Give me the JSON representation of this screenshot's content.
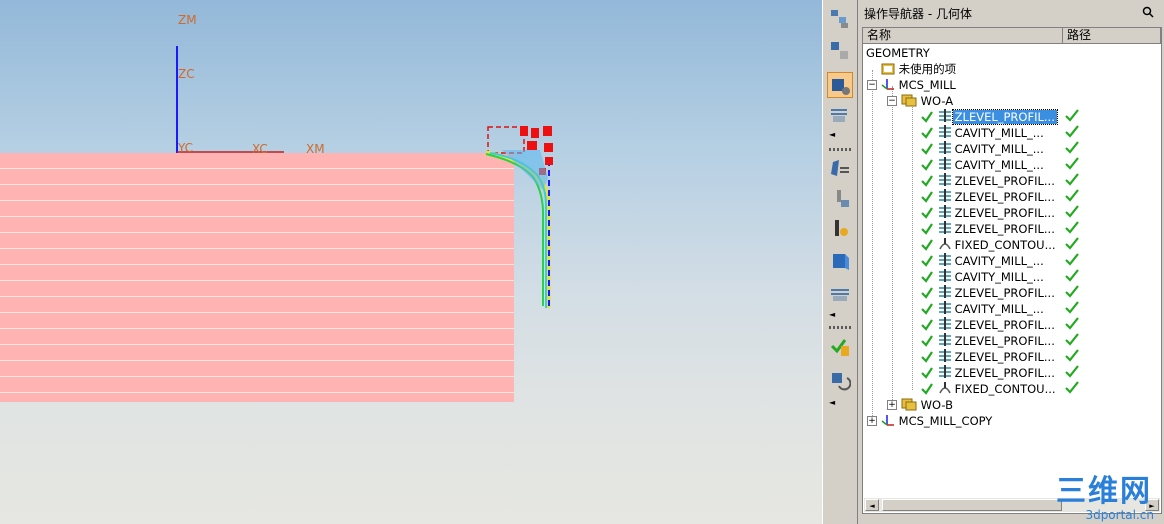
{
  "viewport": {
    "axes": {
      "zm": "ZM",
      "zc": "ZC",
      "yc": "YC",
      "xc": "XC",
      "xm": "XM"
    }
  },
  "navigator": {
    "title": "操作导航器 - 几何体",
    "columns": {
      "name": "名称",
      "path": "路径"
    },
    "tree": {
      "root": "GEOMETRY",
      "unused": "未使用的项",
      "mcs_mill": "MCS_MILL",
      "wo_a": "WO-A",
      "operations": [
        {
          "label": "ZLEVEL_PROFIL...",
          "type": "zlevel",
          "selected": true
        },
        {
          "label": "CAVITY_MILL_...",
          "type": "cavity"
        },
        {
          "label": "CAVITY_MILL_...",
          "type": "cavity"
        },
        {
          "label": "CAVITY_MILL_...",
          "type": "cavity"
        },
        {
          "label": "ZLEVEL_PROFIL...",
          "type": "zlevel"
        },
        {
          "label": "ZLEVEL_PROFIL...",
          "type": "zlevel"
        },
        {
          "label": "ZLEVEL_PROFIL...",
          "type": "zlevel"
        },
        {
          "label": "ZLEVEL_PROFIL...",
          "type": "zlevel"
        },
        {
          "label": "FIXED_CONTOU...",
          "type": "fixed"
        },
        {
          "label": "CAVITY_MILL_...",
          "type": "cavity"
        },
        {
          "label": "CAVITY_MILL_...",
          "type": "cavity"
        },
        {
          "label": "ZLEVEL_PROFIL...",
          "type": "zlevel"
        },
        {
          "label": "CAVITY_MILL_...",
          "type": "cavity"
        },
        {
          "label": "ZLEVEL_PROFIL...",
          "type": "zlevel"
        },
        {
          "label": "ZLEVEL_PROFIL...",
          "type": "zlevel"
        },
        {
          "label": "ZLEVEL_PROFIL...",
          "type": "zlevel"
        },
        {
          "label": "ZLEVEL_PROFIL...",
          "type": "zlevel"
        },
        {
          "label": "FIXED_CONTOU...",
          "type": "fixed"
        }
      ],
      "wo_b": "WO-B",
      "mcs_mill_copy": "MCS_MILL_COPY"
    },
    "watermark": {
      "logo": "三维网",
      "url": "3dportal.cn"
    }
  },
  "colors": {
    "selection": "#3a8fe0",
    "check": "#22aa22",
    "axis": "#1a1aff",
    "part": "#ffb3b3"
  }
}
